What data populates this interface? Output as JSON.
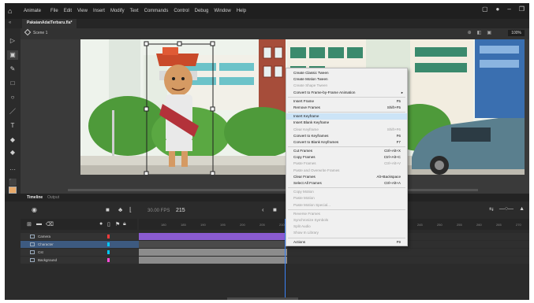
{
  "menubar": {
    "app_name": "Animate",
    "items": [
      "File",
      "Edit",
      "View",
      "Insert",
      "Modify",
      "Text",
      "Commands",
      "Control",
      "Debug",
      "Window",
      "Help"
    ]
  },
  "document": {
    "tab_title": "PakaianAdatTerbaru.fla*"
  },
  "scenebar": {
    "scene_label": "Scene 1",
    "zoom": "100%"
  },
  "timeline": {
    "tabs": [
      "Timeline",
      "Output"
    ],
    "fps": "30.00 FPS",
    "current_frame": "215",
    "ruler_ticks": [
      "180",
      "185",
      "190",
      "195",
      "200",
      "205",
      "210",
      "215",
      "220",
      "225",
      "230",
      "235",
      "240",
      "245",
      "250",
      "255",
      "260",
      "265",
      "270"
    ],
    "layers": [
      {
        "name": "Camera",
        "color": "#ff3b3b"
      },
      {
        "name": "Character",
        "color": "#00c8ff"
      },
      {
        "name": "Cst",
        "color": "#00c8ff"
      },
      {
        "name": "Background",
        "color": "#ff4bd8"
      }
    ],
    "colors": {
      "selected_layer": "#3d5a80",
      "camera_span": "#8a5bd1",
      "character_span": "#4a4a4a",
      "playhead": "#3b82f6"
    }
  },
  "context_menu": {
    "groups": [
      [
        {
          "label": "Create Classic Tween",
          "shortcut": "",
          "disabled": false
        },
        {
          "label": "Create Motion Tween",
          "shortcut": "",
          "disabled": false
        },
        {
          "label": "Create Shape Tween",
          "shortcut": "",
          "disabled": true
        },
        {
          "label": "Convert to Frame-by-Frame Animation",
          "shortcut": "",
          "disabled": false,
          "submenu": true
        }
      ],
      [
        {
          "label": "Insert Frame",
          "shortcut": "F5",
          "disabled": false
        },
        {
          "label": "Remove Frames",
          "shortcut": "Shift+F5",
          "disabled": false
        }
      ],
      [
        {
          "label": "Insert Keyframe",
          "shortcut": "",
          "disabled": false,
          "highlight": true
        },
        {
          "label": "Insert Blank Keyframe",
          "shortcut": "",
          "disabled": false
        },
        {
          "label": "Clear Keyframe",
          "shortcut": "Shift+F6",
          "disabled": true
        },
        {
          "label": "Convert to Keyframes",
          "shortcut": "F6",
          "disabled": false
        },
        {
          "label": "Convert to Blank Keyframes",
          "shortcut": "F7",
          "disabled": false
        }
      ],
      [
        {
          "label": "Cut Frames",
          "shortcut": "Ctrl+Alt+X",
          "disabled": false
        },
        {
          "label": "Copy Frames",
          "shortcut": "Ctrl+Alt+C",
          "disabled": false
        },
        {
          "label": "Paste Frames",
          "shortcut": "Ctrl+Alt+V",
          "disabled": true
        },
        {
          "label": "Paste and Overwrite Frames",
          "shortcut": "",
          "disabled": true
        },
        {
          "label": "Clear Frames",
          "shortcut": "Alt+Backspace",
          "disabled": false
        },
        {
          "label": "Select All Frames",
          "shortcut": "Ctrl+Alt+A",
          "disabled": false
        }
      ],
      [
        {
          "label": "Copy Motion",
          "shortcut": "",
          "disabled": true
        },
        {
          "label": "Paste Motion",
          "shortcut": "",
          "disabled": true
        },
        {
          "label": "Paste Motion Special...",
          "shortcut": "",
          "disabled": true
        }
      ],
      [
        {
          "label": "Reverse Frames",
          "shortcut": "",
          "disabled": true
        },
        {
          "label": "Synchronize Symbols",
          "shortcut": "",
          "disabled": true
        },
        {
          "label": "Split Audio",
          "shortcut": "",
          "disabled": true
        },
        {
          "label": "Show In Library",
          "shortcut": "",
          "disabled": true
        }
      ],
      [
        {
          "label": "Actions",
          "shortcut": "F9",
          "disabled": false
        }
      ]
    ]
  }
}
